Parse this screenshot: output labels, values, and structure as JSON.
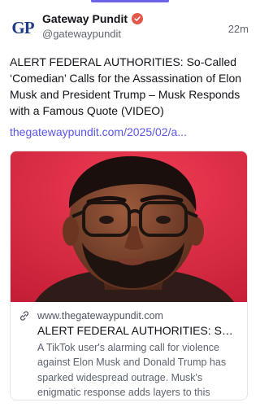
{
  "post": {
    "author": {
      "avatar_text": "GP",
      "display_name": "Gateway Pundit",
      "handle": "@gatewaypundit",
      "verified_icon": "verified-badge-icon"
    },
    "timestamp": "22m",
    "text": "ALERT FEDERAL AUTHORITIES: So-Called ‘Comedian’ Calls for the Assassination of Elon Musk and President Trump – Musk Responds with a Famous Quote (VIDEO)",
    "link_text": "thegatewaypundit.com/2025/02/a...",
    "card": {
      "domain": "www.thegatewaypundit.com",
      "title": "ALERT FEDERAL AUTHORITIES: So-Called ‘Comedian’ Calls for the Assassination of Elon Musk and President Trump",
      "description": "A TikTok user's alarming call for violence against Elon Musk and Donald Trump has sparked widespread outrage. Musk's enigmatic response adds layers to this unfol...",
      "image_alt": "Close-up photo of a man with glasses against a red background"
    }
  },
  "colors": {
    "accent": "#6d63e8",
    "link": "#5a57e8",
    "verified": "#e4584a",
    "avatar_blue": "#1f3c86"
  }
}
